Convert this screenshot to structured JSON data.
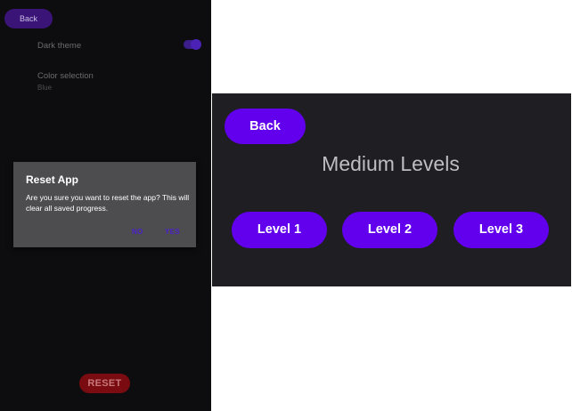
{
  "settings_screen": {
    "back_label": "Back",
    "dark_theme": {
      "title": "Dark theme",
      "enabled": true
    },
    "color_selection": {
      "title": "Color selection",
      "value": "Blue"
    },
    "reset_dialog": {
      "title": "Reset App",
      "message": "Are you sure you want to reset the app? This will clear all saved progress.",
      "no_label": "NO",
      "yes_label": "YES"
    },
    "reset_label": "RESET"
  },
  "levels_screen": {
    "back_label": "Back",
    "title": "Medium Levels",
    "levels": [
      {
        "label": "Level 1"
      },
      {
        "label": "Level 2"
      },
      {
        "label": "Level 3"
      }
    ]
  },
  "colors": {
    "primary": "#6200ee",
    "screen_bg": "#1f1f23",
    "dialog_bg": "#4d4d4f",
    "reset_red": "#7a0b10"
  }
}
